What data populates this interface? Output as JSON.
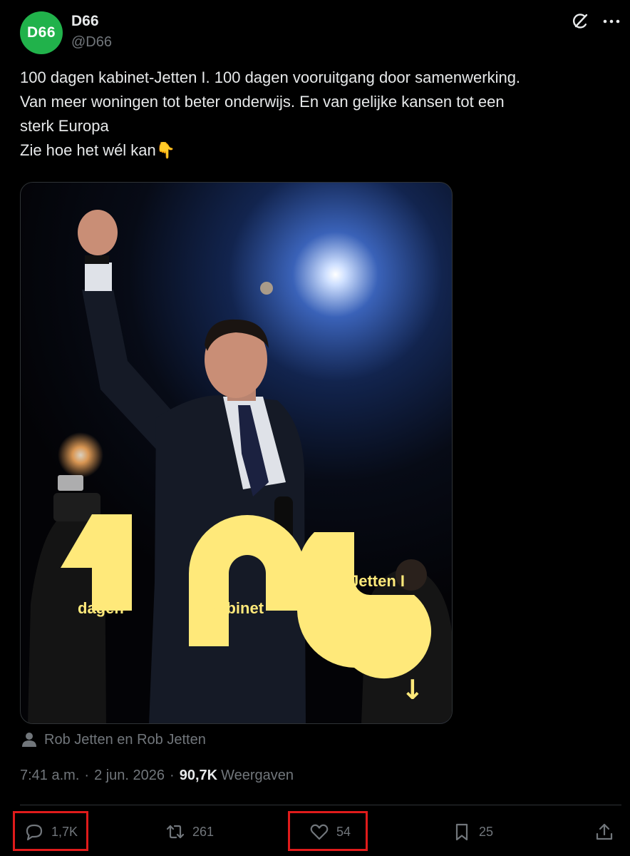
{
  "author": {
    "avatar_text": "D66",
    "name": "D66",
    "handle": "@D66"
  },
  "icons": {
    "grok": "grok-icon",
    "more": "more-icon",
    "reply": "reply-icon",
    "repost": "repost-icon",
    "like": "heart-icon",
    "bookmark": "bookmark-icon",
    "share": "share-icon",
    "person": "person-icon",
    "emoji": "pointing-down-hand-emoji"
  },
  "tweet": {
    "text": "100 dagen kabinet-Jetten I. 100 dagen vooruitgang door samenwerking.\nVan meer woningen tot beter onderwijs. En van gelijke kansen tot een\nsterk Europa\nZie hoe het wél kan👇"
  },
  "media": {
    "big_number": "100",
    "label_dagen": "dagen",
    "label_kabinet": "kabinet",
    "label_jetten": "Jetten I",
    "arrow": "↓"
  },
  "tagged_people": "Rob Jetten en Rob Jetten",
  "meta": {
    "time": "7:41 a.m.",
    "separator": "·",
    "date": "2 jun. 2026",
    "views_count": "90,7K",
    "views_label": "Weergaven"
  },
  "actions": {
    "replies": "1,7K",
    "reposts": "261",
    "likes": "54",
    "bookmarks": "25"
  },
  "colors": {
    "background": "#000000",
    "text": "#e7e9ea",
    "muted": "#71767b",
    "avatar_green": "#21b24b",
    "brand_yellow": "#ffe97a",
    "highlight_red": "#e01b1b"
  }
}
